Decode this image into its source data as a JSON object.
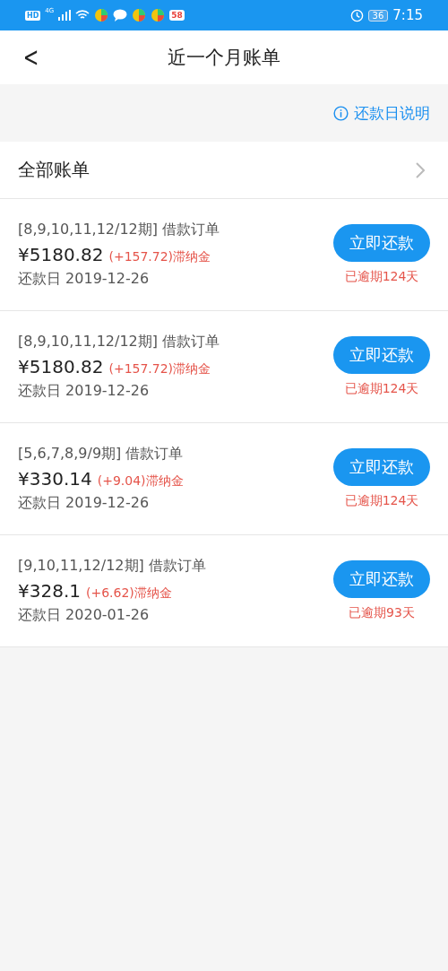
{
  "status_bar": {
    "hd": "HD",
    "network": "4G",
    "app_badge": "58",
    "battery": "36",
    "time": "7:15"
  },
  "header": {
    "back": "<",
    "title": "近一个月账单"
  },
  "info_link": "还款日说明",
  "all_bills": {
    "label": "全部账单"
  },
  "bills": [
    {
      "title": "[8,9,10,11,12/12期] 借款订单",
      "amount": "¥5180.82",
      "late_fee": "(+157.72)滞纳金",
      "due": "还款日 2019-12-26",
      "button": "立即还款",
      "overdue": "已逾期124天"
    },
    {
      "title": "[8,9,10,11,12/12期] 借款订单",
      "amount": "¥5180.82",
      "late_fee": "(+157.72)滞纳金",
      "due": "还款日 2019-12-26",
      "button": "立即还款",
      "overdue": "已逾期124天"
    },
    {
      "title": "[5,6,7,8,9/9期] 借款订单",
      "amount": "¥330.14",
      "late_fee": "(+9.04)滞纳金",
      "due": "还款日 2019-12-26",
      "button": "立即还款",
      "overdue": "已逾期124天"
    },
    {
      "title": "[9,10,11,12/12期] 借款订单",
      "amount": "¥328.1",
      "late_fee": "(+6.62)滞纳金",
      "due": "还款日 2020-01-26",
      "button": "立即还款",
      "overdue": "已逾期93天"
    }
  ]
}
